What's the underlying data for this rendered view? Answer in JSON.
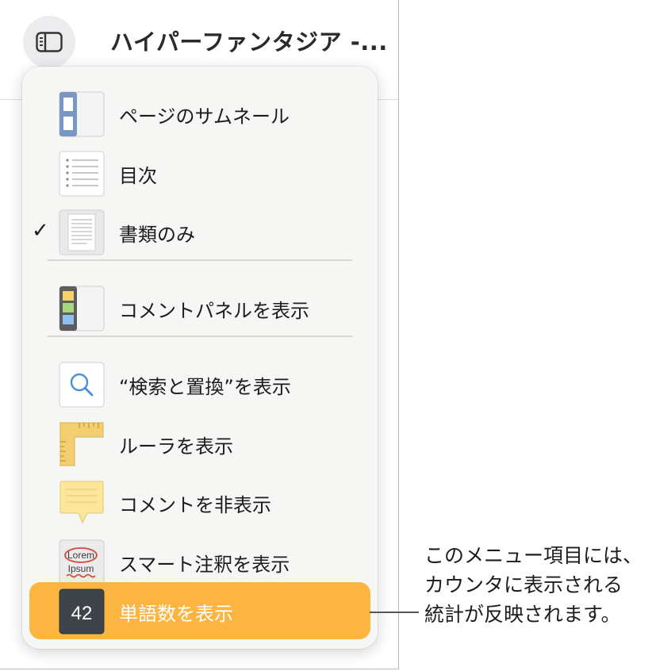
{
  "window": {
    "title": "ハイパーファンタジア -..."
  },
  "menu": {
    "items": [
      {
        "label": "ページのサムネール",
        "icon": "page-thumbnails-icon",
        "checked": false
      },
      {
        "label": "目次",
        "icon": "table-of-contents-icon",
        "checked": false
      },
      {
        "label": "書類のみ",
        "icon": "document-only-icon",
        "checked": true,
        "check_mark": "✓"
      },
      {
        "label": "コメントパネルを表示",
        "icon": "comments-pane-icon",
        "checked": false
      },
      {
        "label": "“検索と置換”を表示",
        "icon": "search-icon",
        "checked": false
      },
      {
        "label": "ルーラを表示",
        "icon": "ruler-icon",
        "checked": false
      },
      {
        "label": "コメントを非表示",
        "icon": "comment-note-icon",
        "checked": false
      },
      {
        "label": "スマート注釈を表示",
        "icon": "smart-annotation-icon",
        "checked": false,
        "icon_text": {
          "top": "Lorem",
          "bottom": "Ipsum"
        }
      },
      {
        "label": "単語数を表示",
        "icon": "word-count-icon",
        "checked": false,
        "highlighted": true,
        "icon_text": "42"
      }
    ]
  },
  "callout": {
    "lines": [
      "このメニュー項目には、",
      "カウンタに表示される",
      "統計が反映されます。"
    ]
  },
  "colors": {
    "highlight": "#fbb540",
    "menu_background": "#f6f6f4",
    "icon_blue": "#6c8ebf"
  }
}
